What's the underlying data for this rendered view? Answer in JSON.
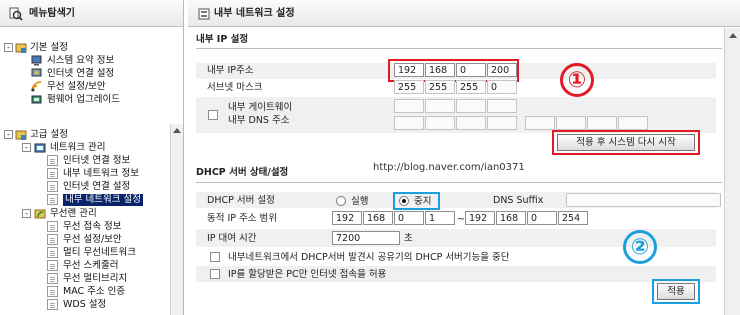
{
  "sidebar": {
    "title": "메뉴탐색기",
    "groups": [
      {
        "label": "기본 설정",
        "items": [
          "시스템 요약 정보",
          "인터넷 연결 설정",
          "무선 설정/보안",
          "펌웨어 업그레이드"
        ]
      },
      {
        "label": "고급 설정"
      }
    ],
    "network": {
      "label": "네트워크 관리",
      "items": [
        "인터넷 연결 정보",
        "내부 네트워크 정보",
        "인터넷 연결 설정",
        "내부 네트워크 설정"
      ]
    },
    "wireless": {
      "label": "무선랜 관리",
      "items": [
        "무선 접속 정보",
        "무선 설정/보안",
        "멀티 무선네트워크",
        "무선 스케줄러",
        "무선 멀티브리지",
        "MAC 주소 인증",
        "WDS 설정"
      ]
    }
  },
  "main": {
    "title": "내부 네트워크 설정",
    "ip_section": {
      "title": "내부 IP 설정",
      "ip_label": "내부 IP주소",
      "ip": [
        "192",
        "168",
        "0",
        "200"
      ],
      "subnet_label": "서브넷 마스크",
      "subnet": [
        "255",
        "255",
        "255",
        "0"
      ],
      "gw_label1": "내부 게이트웨이",
      "gw_label2": "내부 DNS 주소",
      "apply_restart": "적용 후 시스템 다시 시작"
    },
    "watermark": "http://blog.naver.com/ian0371",
    "dhcp_section": {
      "title": "DHCP 서버 상태/설정",
      "server_label": "DHCP 서버 설정",
      "run_label": "실행",
      "stop_label": "중지",
      "dns_suffix_label": "DNS Suffix",
      "range_label": "동적 IP 주소 범위",
      "range_start": [
        "192",
        "168",
        "0",
        "1"
      ],
      "range_tilde": "~",
      "range_end": [
        "192",
        "168",
        "0",
        "254"
      ],
      "lease_label": "IP 대여 시간",
      "lease_value": "7200",
      "lease_unit": "초",
      "chk1": "내부네트워크에서 DHCP서버 발견시 공유기의 DHCP 서버기능을 중단",
      "chk2": "IP를 할당받은 PC만 인터넷 접속을 허용",
      "apply": "적용"
    },
    "annotations": {
      "one": "①",
      "two": "②",
      "red": "#e01b24",
      "blue": "#1ca0dd"
    }
  }
}
